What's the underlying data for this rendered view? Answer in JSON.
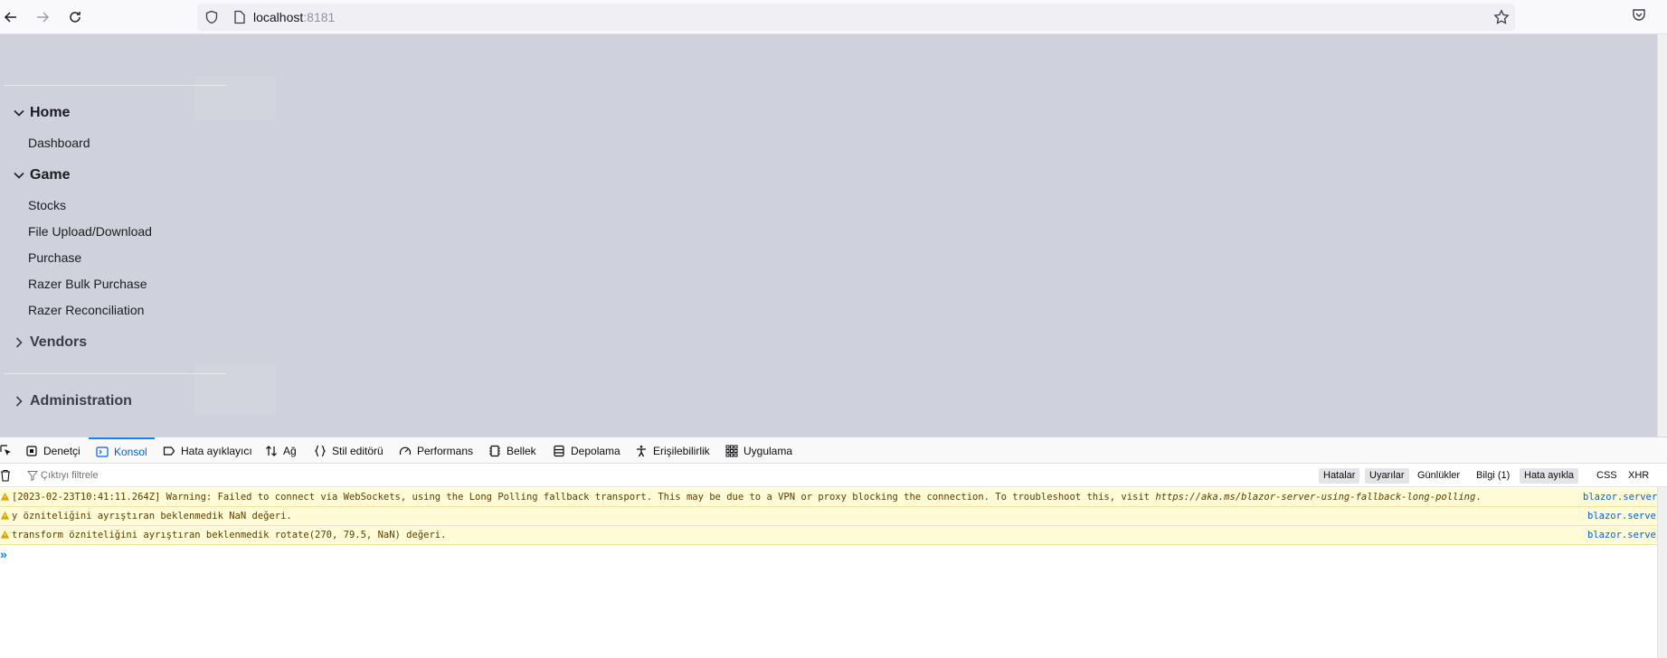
{
  "browser": {
    "url_host": "localhost",
    "url_port": ":8181"
  },
  "sidebar": {
    "groups": [
      {
        "label": "Home",
        "expanded": true,
        "items": [
          {
            "label": "Dashboard"
          }
        ]
      },
      {
        "label": "Game",
        "expanded": true,
        "items": [
          {
            "label": "Stocks"
          },
          {
            "label": "File Upload/Download"
          },
          {
            "label": "Purchase"
          },
          {
            "label": "Razer Bulk Purchase"
          },
          {
            "label": "Razer Reconciliation"
          }
        ]
      },
      {
        "label": "Vendors",
        "expanded": false,
        "items": []
      },
      {
        "label": "Administration",
        "expanded": false,
        "items": []
      }
    ]
  },
  "devtools": {
    "tabs": [
      {
        "label": "Denetçi",
        "icon": "inspector-icon"
      },
      {
        "label": "Konsol",
        "icon": "console-icon",
        "active": true
      },
      {
        "label": "Hata ayıklayıcı",
        "icon": "debugger-icon"
      },
      {
        "label": "Ağ",
        "icon": "network-icon"
      },
      {
        "label": "Stil editörü",
        "icon": "style-editor-icon"
      },
      {
        "label": "Performans",
        "icon": "performance-icon"
      },
      {
        "label": "Bellek",
        "icon": "memory-icon"
      },
      {
        "label": "Depolama",
        "icon": "storage-icon"
      },
      {
        "label": "Erişilebilirlik",
        "icon": "accessibility-icon"
      },
      {
        "label": "Uygulama",
        "icon": "application-icon"
      }
    ],
    "filter_placeholder": "Çıktıyı filtrele",
    "filter_buttons": [
      {
        "label": "Hatalar",
        "on": true
      },
      {
        "label": "Uyarılar",
        "on": true
      },
      {
        "label": "Günlükler",
        "on": false
      },
      {
        "label": "Bilgi (1)",
        "on": false
      },
      {
        "label": "Hata ayıkla",
        "on": true
      },
      {
        "label": "CSS",
        "on": false
      },
      {
        "label": "XHR",
        "on": false
      }
    ],
    "messages": [
      {
        "text": "[2023-02-23T10:41:11.264Z] Warning: Failed to connect via WebSockets, using the Long Polling fallback transport. This may be due to a VPN or proxy blocking the connection. To troubleshoot this, visit ",
        "link": "https://aka.ms/blazor-server-using-fallback-long-polling",
        "suffix": ".",
        "source": "blazor.server.js"
      },
      {
        "text": "y özniteliğini ayrıştıran beklenmedik NaN değeri.",
        "link": "",
        "suffix": "",
        "source": "blazor.server.js"
      },
      {
        "text": "transform özniteliğini ayrıştıran beklenmedik rotate(270, 79.5, NaN) değeri.",
        "link": "",
        "suffix": "",
        "source": "blazor.server.js"
      }
    ],
    "prompt_symbol": "»"
  }
}
